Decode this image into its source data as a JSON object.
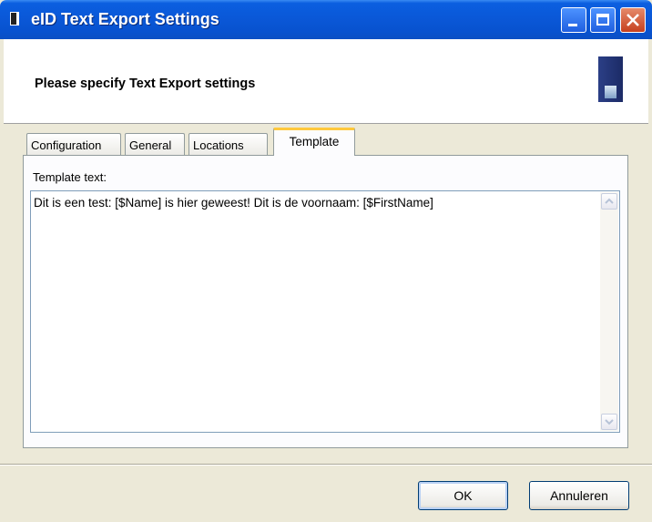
{
  "window": {
    "title": "eID Text Export Settings"
  },
  "header": {
    "heading": "Please specify Text Export settings"
  },
  "tabs": [
    {
      "label": "Configuration"
    },
    {
      "label": "General"
    },
    {
      "label": "Locations"
    },
    {
      "label": "Template",
      "active": true
    }
  ],
  "template": {
    "label": "Template text:",
    "value": "Dit is een test: [$Name] is hier geweest! Dit is de voornaam: [$FirstName]"
  },
  "buttons": {
    "ok": "OK",
    "cancel": "Annuleren"
  },
  "colors": {
    "titlebar": "#0a58d8",
    "active_tab_accent": "#ffc83c",
    "dialog_bg": "#ece9d8"
  },
  "icons": [
    "app-icon",
    "minimize-icon",
    "maximize-icon",
    "close-icon",
    "header-logo-icon",
    "scroll-up-icon",
    "scroll-down-icon"
  ]
}
